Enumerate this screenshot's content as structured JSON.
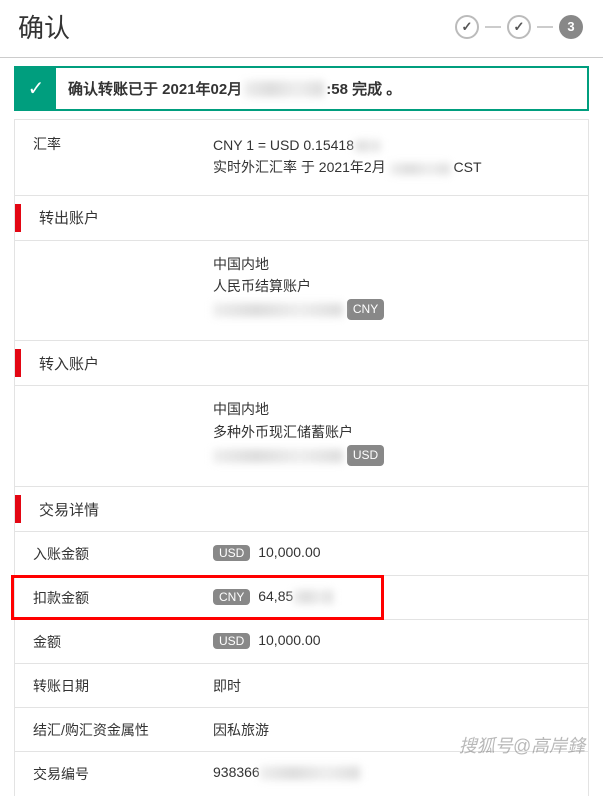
{
  "header": {
    "title": "确认",
    "step3": "3"
  },
  "alert": {
    "prefix": "确认转账已于 2021年02月",
    "suffix": ":58 完成 。"
  },
  "rate": {
    "label": "汇率",
    "line1": "CNY 1 = USD 0.15418",
    "line2_prefix": "实时外汇汇率 于 2021年2月",
    "line2_suffix": "CST"
  },
  "from": {
    "heading": "转出账户",
    "region": "中国内地",
    "acct_type": "人民币结算账户",
    "currency": "CNY"
  },
  "to": {
    "heading": "转入账户",
    "region": "中国内地",
    "acct_type": "多种外币现汇储蓄账户",
    "currency": "USD"
  },
  "details": {
    "heading": "交易详情",
    "credit_label": "入账金额",
    "credit_currency": "USD",
    "credit_value": "10,000.00",
    "debit_label": "扣款金额",
    "debit_currency": "CNY",
    "debit_value": "64,85",
    "amount_label": "金额",
    "amount_currency": "USD",
    "amount_value": "10,000.00",
    "date_label": "转账日期",
    "date_value": "即时",
    "purpose_label": "结汇/购汇资金属性",
    "purpose_value": "因私旅游",
    "txn_label": "交易编号",
    "txn_value": "938366"
  },
  "watermark": "搜狐号@高岸鋒"
}
